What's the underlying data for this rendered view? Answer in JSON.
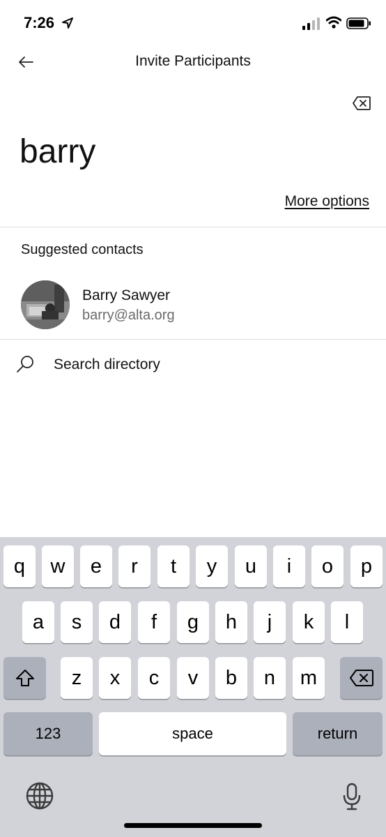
{
  "status_bar": {
    "time": "7:26"
  },
  "header": {
    "title": "Invite Participants",
    "back_icon": "arrow-left-icon",
    "clear_icon": "backspace-icon"
  },
  "search": {
    "query": "barry",
    "more_options_label": "More options"
  },
  "suggested": {
    "section_title": "Suggested contacts",
    "contacts": [
      {
        "name": "Barry Sawyer",
        "email": "barry@alta.org"
      }
    ]
  },
  "directory": {
    "label": "Search directory",
    "icon": "search-icon"
  },
  "keyboard": {
    "row1": [
      "q",
      "w",
      "e",
      "r",
      "t",
      "y",
      "u",
      "i",
      "o",
      "p"
    ],
    "row2": [
      "a",
      "s",
      "d",
      "f",
      "g",
      "h",
      "j",
      "k",
      "l"
    ],
    "row3": [
      "z",
      "x",
      "c",
      "v",
      "b",
      "n",
      "m"
    ],
    "numbers_label": "123",
    "space_label": "space",
    "return_label": "return",
    "shift_icon": "shift-icon",
    "delete_icon": "backspace-icon",
    "globe_icon": "globe-icon",
    "mic_icon": "microphone-icon"
  }
}
